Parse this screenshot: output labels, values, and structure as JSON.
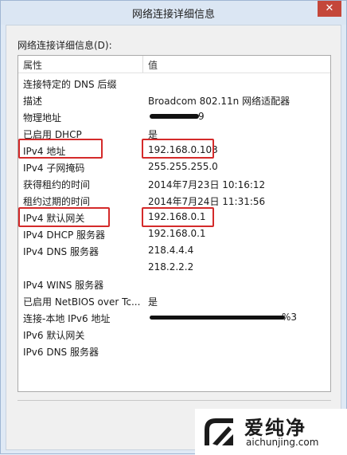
{
  "window": {
    "title": "网络连接详细信息",
    "close_symbol": "✕"
  },
  "section_label": "网络连接详细信息(D):",
  "columns": {
    "property": "属性",
    "value": "值"
  },
  "rows": [
    {
      "property": "连接特定的 DNS 后缀",
      "value": ""
    },
    {
      "property": "描述",
      "value": "Broadcom 802.11n 网络适配器"
    },
    {
      "property": "物理地址",
      "value": "9"
    },
    {
      "property": "已启用 DHCP",
      "value": "是"
    },
    {
      "property": "IPv4 地址",
      "value": "192.168.0.103"
    },
    {
      "property": "IPv4 子网掩码",
      "value": "255.255.255.0"
    },
    {
      "property": "获得租约的时间",
      "value": "2014年7月23日 10:16:12"
    },
    {
      "property": "租约过期的时间",
      "value": "2014年7月24日 11:31:56"
    },
    {
      "property": "IPv4 默认网关",
      "value": "192.168.0.1"
    },
    {
      "property": "IPv4 DHCP 服务器",
      "value": "192.168.0.1"
    },
    {
      "property": "IPv4 DNS 服务器",
      "value": "218.4.4.4"
    },
    {
      "property": "",
      "value": "218.2.2.2"
    },
    {
      "property": "IPv4 WINS 服务器",
      "value": ""
    },
    {
      "property": "已启用 NetBIOS over Tc...",
      "value": "是"
    },
    {
      "property": "连接-本地 IPv6 地址",
      "value": "%3"
    },
    {
      "property": "IPv6 默认网关",
      "value": ""
    },
    {
      "property": "IPv6 DNS 服务器",
      "value": ""
    }
  ],
  "watermark": {
    "name": "爱纯净",
    "url": "aichunjing.com"
  },
  "colors": {
    "highlight": "#d42a2a",
    "close_button": "#c4473a"
  }
}
